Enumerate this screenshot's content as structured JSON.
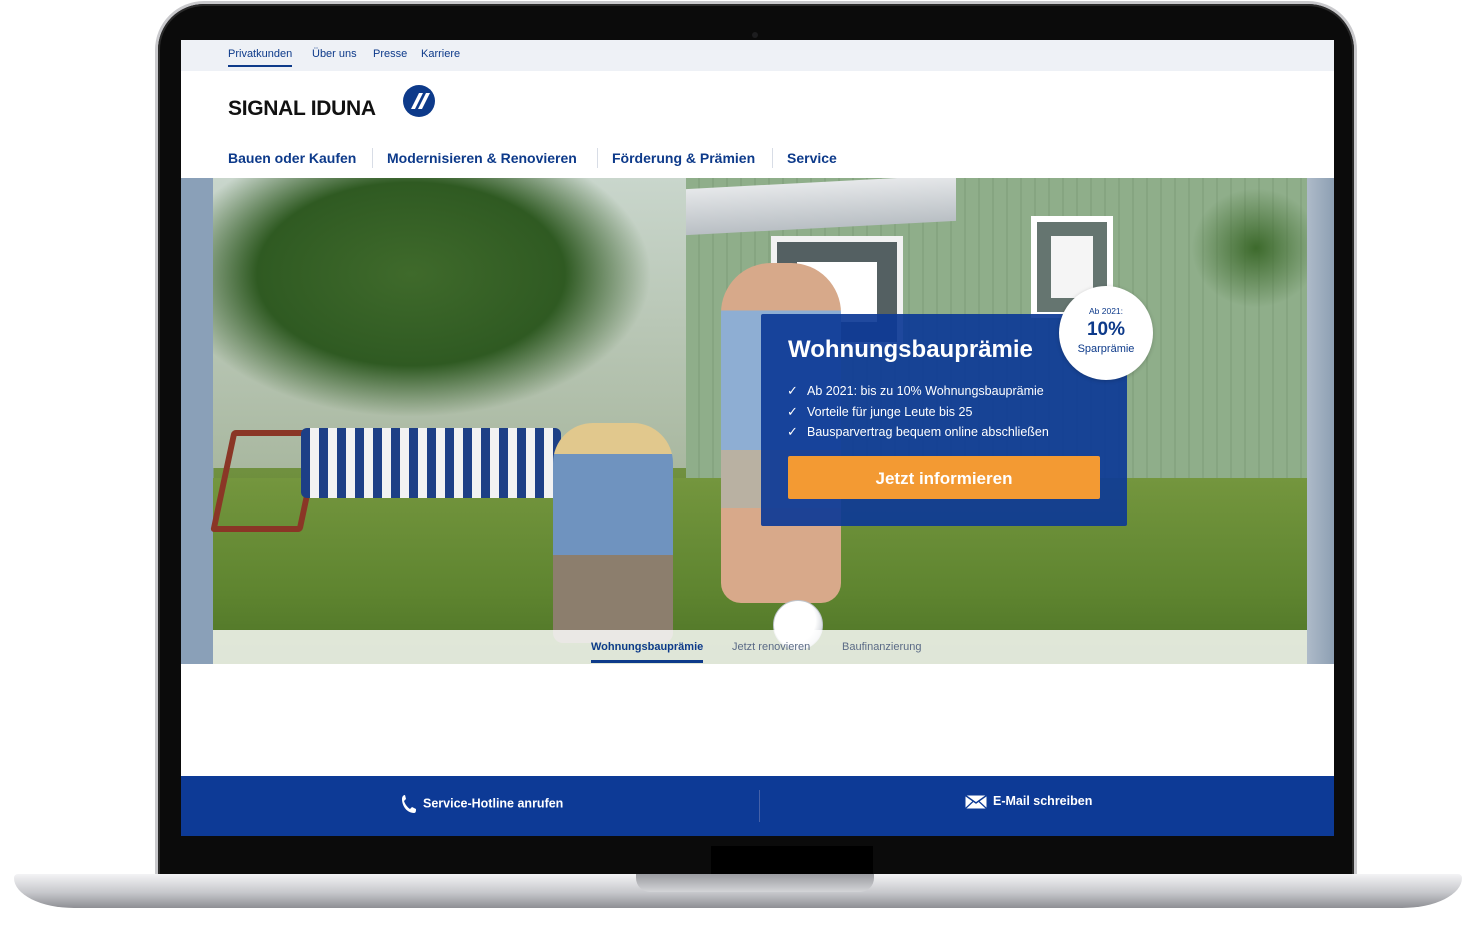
{
  "top_nav": {
    "items": [
      {
        "label": "Privatkunden",
        "active": true
      },
      {
        "label": "Über uns",
        "active": false
      },
      {
        "label": "Presse",
        "active": false
      },
      {
        "label": "Karriere",
        "active": false
      }
    ]
  },
  "brand": {
    "logo_text": "SIGNAL IDUNA",
    "logo_icon": "signal-iduna-logo-mark",
    "color": "#0d3a8a"
  },
  "main_nav": {
    "items": [
      {
        "label": "Bauen oder Kaufen"
      },
      {
        "label": "Modernisieren & Renovieren"
      },
      {
        "label": "Förderung & Prämien"
      },
      {
        "label": "Service"
      }
    ]
  },
  "hero": {
    "promo": {
      "title": "Wohnungsbauprämie",
      "bullets": [
        "Ab 2021: bis zu 10% Wohnungsbauprämie",
        "Vorteile für junge Leute bis 25",
        "Bausparvertrag bequem online abschließen"
      ],
      "cta_label": "Jetzt informieren",
      "cta_color": "#f39a33",
      "card_color": "#0d3a96"
    },
    "badge": {
      "line1": "Ab 2021:",
      "line2": "10%",
      "line3": "Sparprämie"
    },
    "tabs": [
      {
        "label": "Wohnungsbauprämie",
        "active": true
      },
      {
        "label": "Jetzt renovieren",
        "active": false
      },
      {
        "label": "Baufinanzierung",
        "active": false
      }
    ]
  },
  "footer": {
    "hotline_label": "Service-Hotline anrufen",
    "hotline_icon": "phone-icon",
    "email_label": "E-Mail schreiben",
    "email_icon": "envelope-icon",
    "bar_color": "#0d3a96"
  }
}
